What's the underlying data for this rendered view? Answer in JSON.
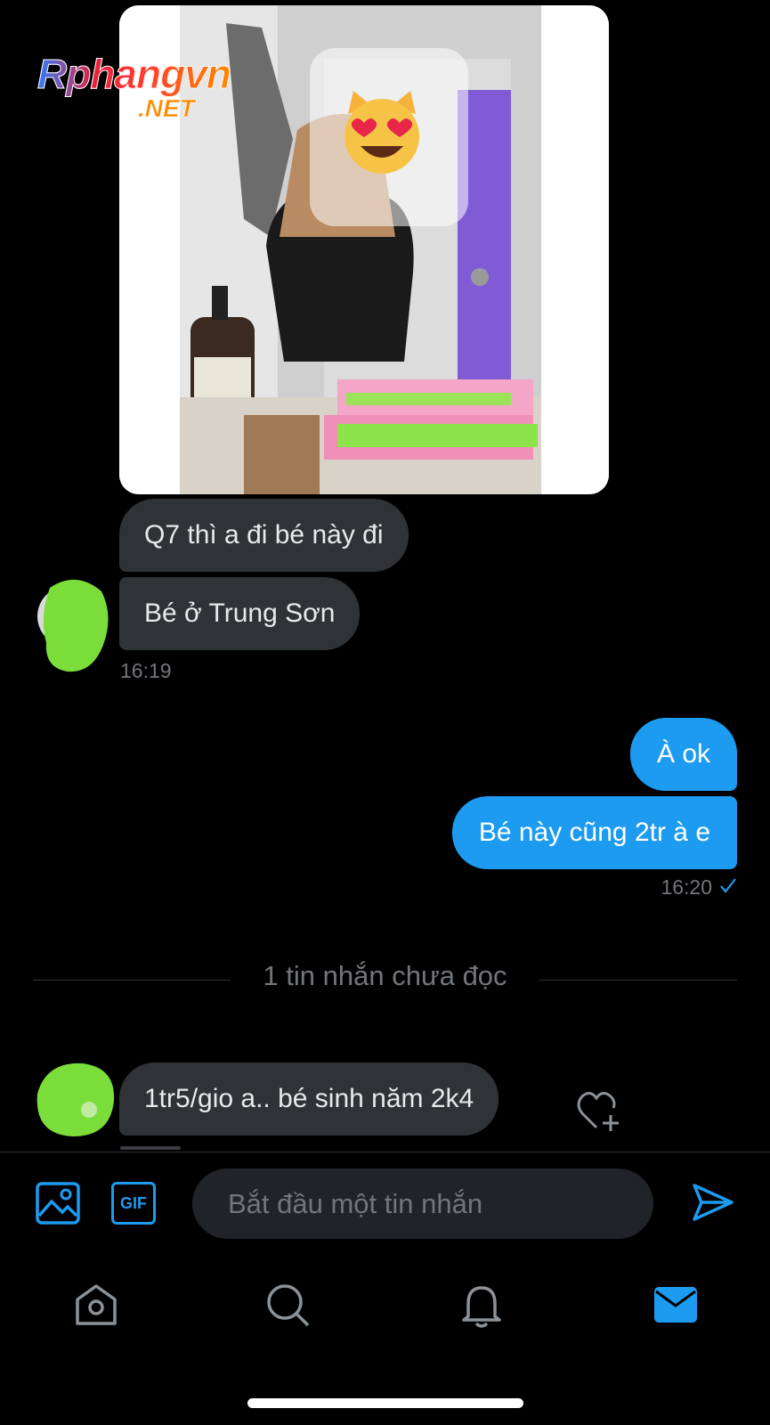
{
  "watermark": {
    "main": "Rphangvn",
    "suffix": ".NET"
  },
  "messages": {
    "incoming_1": "Q7 thì a đi bé này đi",
    "incoming_2": "Bé ở Trung Sơn",
    "incoming_time": "16:19",
    "outgoing_1": "À ok",
    "outgoing_2": "Bé này cũng 2tr à e",
    "outgoing_time": "16:20",
    "unread_label": "1 tin nhắn chưa đọc",
    "incoming_3": "1tr5/gio a.. bé sinh năm 2k4"
  },
  "composer": {
    "placeholder": "Bắt đầu một tin nhắn",
    "gif_label": "GIF"
  },
  "tabbar": [
    "home-icon",
    "search-icon",
    "bell-icon",
    "mail-icon"
  ],
  "colors": {
    "accent": "#1d9bf0",
    "bubble_in": "#2f3336",
    "background": "#000000"
  }
}
